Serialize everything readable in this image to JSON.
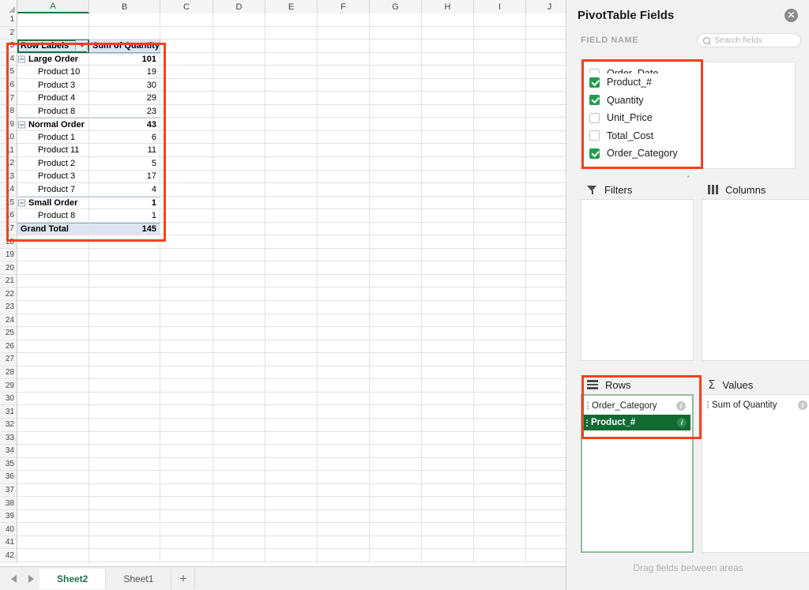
{
  "spreadsheet": {
    "column_headers": [
      "A",
      "B",
      "C",
      "D",
      "E",
      "F",
      "G",
      "H",
      "I",
      "J"
    ],
    "active_column": "A",
    "row_numbers": [
      1,
      2,
      3,
      4,
      5,
      6,
      7,
      8,
      9,
      10,
      11,
      12,
      13,
      14,
      15,
      16,
      17,
      18,
      19,
      20,
      21,
      22,
      23,
      24,
      25,
      26,
      27,
      28,
      29,
      30,
      31,
      32,
      33,
      34,
      35,
      36,
      37,
      38,
      39,
      40,
      41,
      42
    ],
    "selected_cell": "A3",
    "pivot_table": {
      "header": {
        "row_labels": "Row Labels",
        "value_header": "Sum of Quantity"
      },
      "rows": [
        {
          "row": 4,
          "type": "group",
          "label": "Large Order",
          "value": "101"
        },
        {
          "row": 5,
          "type": "item",
          "label": "Product 10",
          "value": "19"
        },
        {
          "row": 6,
          "type": "item",
          "label": "Product 3",
          "value": "30"
        },
        {
          "row": 7,
          "type": "item",
          "label": "Product 4",
          "value": "29"
        },
        {
          "row": 8,
          "type": "item",
          "label": "Product 8",
          "value": "23"
        },
        {
          "row": 9,
          "type": "group",
          "label": "Normal Order",
          "value": "43"
        },
        {
          "row": 10,
          "type": "item",
          "label": "Product 1",
          "value": "6"
        },
        {
          "row": 11,
          "type": "item",
          "label": "Product 11",
          "value": "11"
        },
        {
          "row": 12,
          "type": "item",
          "label": "Product 2",
          "value": "5"
        },
        {
          "row": 13,
          "type": "item",
          "label": "Product 3",
          "value": "17"
        },
        {
          "row": 14,
          "type": "item",
          "label": "Product 7",
          "value": "4"
        },
        {
          "row": 15,
          "type": "group",
          "label": "Small Order",
          "value": "1"
        },
        {
          "row": 16,
          "type": "item",
          "label": "Product 8",
          "value": "1"
        },
        {
          "row": 17,
          "type": "total",
          "label": "Grand Total",
          "value": "145"
        }
      ]
    }
  },
  "sheet_tabs": {
    "tabs": [
      {
        "label": "Sheet2",
        "active": true
      },
      {
        "label": "Sheet1",
        "active": false
      }
    ],
    "add_label": "+"
  },
  "panel": {
    "title": "PivotTable Fields",
    "close_label": "✕",
    "field_name_label": "FIELD NAME",
    "search": {
      "placeholder": "Search fields",
      "value": ""
    },
    "fields": [
      {
        "label": "Order_Date",
        "checked": false,
        "clipped": true
      },
      {
        "label": "Product_#",
        "checked": true,
        "clipped": false
      },
      {
        "label": "Quantity",
        "checked": true,
        "clipped": false
      },
      {
        "label": "Unit_Price",
        "checked": false,
        "clipped": false
      },
      {
        "label": "Total_Cost",
        "checked": false,
        "clipped": false
      },
      {
        "label": "Order_Category",
        "checked": true,
        "clipped": false
      }
    ],
    "areas": {
      "filters": {
        "title": "Filters",
        "items": []
      },
      "columns": {
        "title": "Columns",
        "items": []
      },
      "rows": {
        "title": "Rows",
        "items": [
          {
            "label": "Order_Category",
            "selected": false
          },
          {
            "label": "Product_#",
            "selected": true
          }
        ]
      },
      "values": {
        "title": "Values",
        "items": [
          {
            "label": "Sum of Quantity",
            "selected": false
          }
        ]
      }
    },
    "drag_hint": "Drag fields between areas"
  },
  "colors": {
    "excel_green": "#217346",
    "check_green": "#1e9e4f",
    "selected_pill": "#126a33",
    "annotation_red": "#f5411d",
    "pivot_header_fill": "#dce6f1"
  }
}
